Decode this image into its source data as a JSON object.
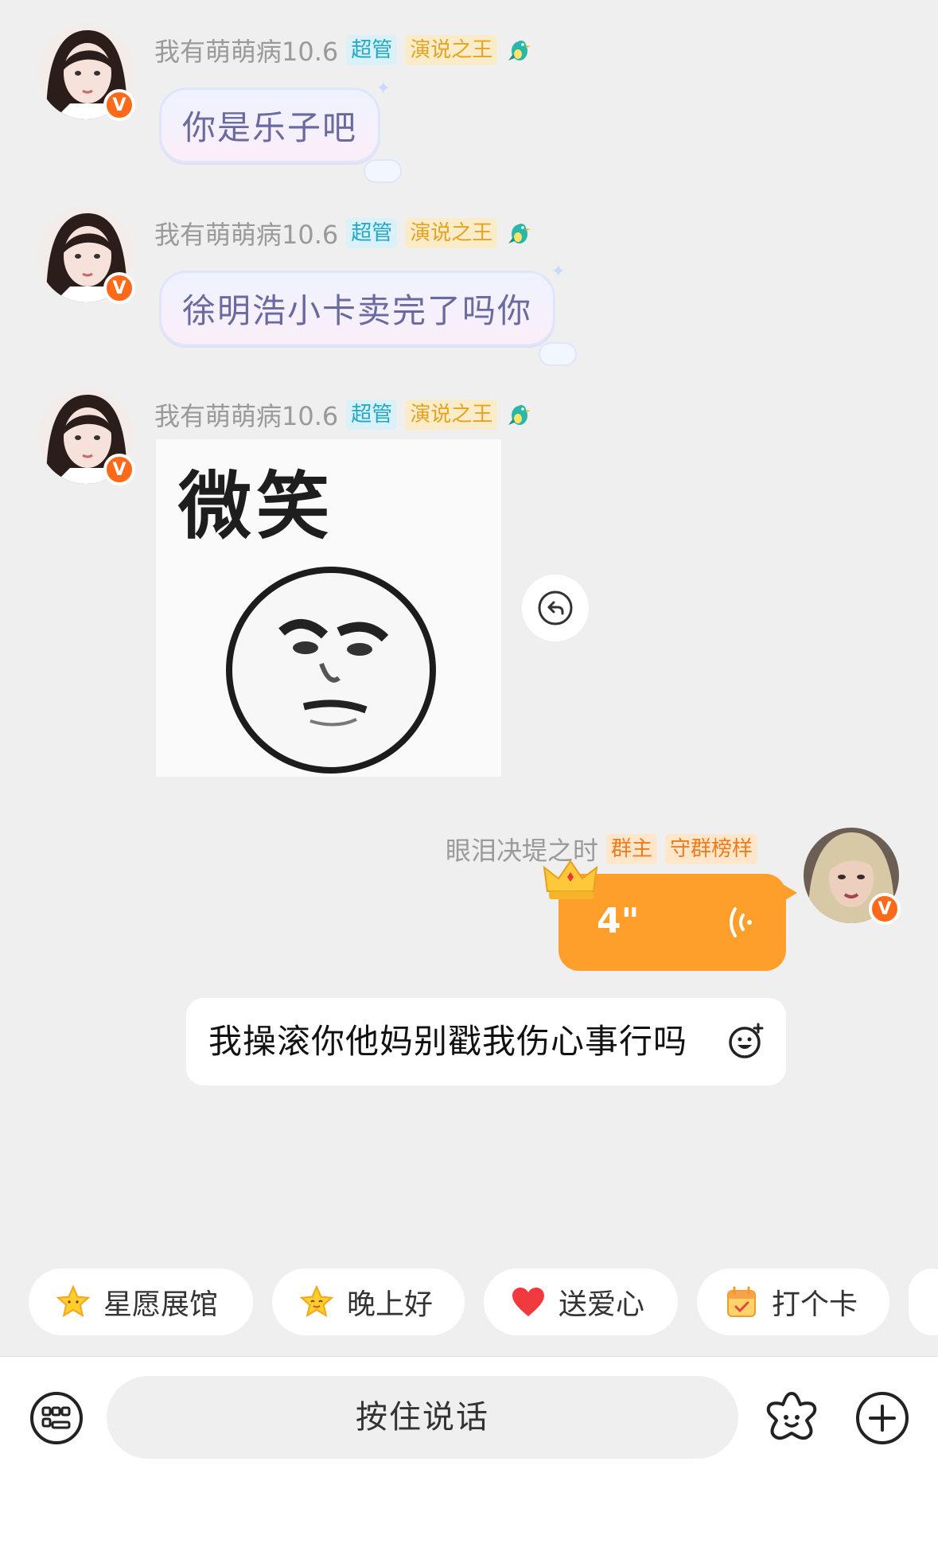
{
  "messages": [
    {
      "sender": "我有萌萌病10.6",
      "tags": [
        "超管",
        "演说之王"
      ],
      "text": "你是乐子吧",
      "verified_badge": "V"
    },
    {
      "sender": "我有萌萌病10.6",
      "tags": [
        "超管",
        "演说之王"
      ],
      "text": "徐明浩小卡卖完了吗你",
      "verified_badge": "V"
    },
    {
      "sender": "我有萌萌病10.6",
      "tags": [
        "超管",
        "演说之王"
      ],
      "sticker_text": "微笑",
      "verified_badge": "V"
    }
  ],
  "own_message": {
    "sender": "眼泪决堤之时",
    "tags": [
      "群主",
      "守群榜样"
    ],
    "voice_length": "4\"",
    "text": "我操滚你他妈别戳我伤心事行吗",
    "verified_badge": "V"
  },
  "quick_chips": [
    {
      "label": "星愿展馆",
      "icon": "star-icon"
    },
    {
      "label": "晚上好",
      "icon": "smiling-star-icon"
    },
    {
      "label": "送爱心",
      "icon": "heart-icon"
    },
    {
      "label": "打个卡",
      "icon": "calendar-icon"
    }
  ],
  "input_bar": {
    "hold_to_talk": "按住说话",
    "left_icon": "keyboard-icon",
    "right_icons": [
      "flower-emoji-icon",
      "plus-icon"
    ]
  },
  "colors": {
    "accent": "#ff9f2b",
    "badge": "#ff6a1a",
    "admin_tag": "#21a8c9",
    "speech_tag": "#e4a321"
  }
}
